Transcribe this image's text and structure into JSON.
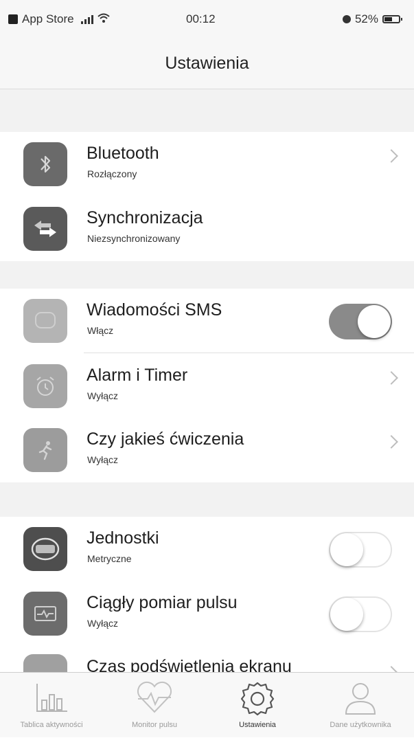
{
  "status_bar": {
    "carrier": "App Store",
    "time": "00:12",
    "battery": "52%"
  },
  "nav": {
    "title": "Ustawienia"
  },
  "sections": [
    {
      "rows": [
        {
          "title": "Bluetooth",
          "subtitle": "Rozłączony",
          "icon": "bluetooth-icon",
          "accessory": "chevron"
        },
        {
          "title": "Synchronizacja",
          "subtitle": "Niezsynchronizowany",
          "icon": "sync-icon",
          "accessory": "none"
        }
      ]
    },
    {
      "rows": [
        {
          "title": "Wiadomości SMS",
          "subtitle": "Włącz",
          "icon": "sms-icon",
          "accessory": "toggle",
          "toggle_on": true
        },
        {
          "title": "Alarm i Timer",
          "subtitle": "Wyłącz",
          "icon": "alarm-clock-icon",
          "accessory": "chevron"
        },
        {
          "title": "Czy jakieś ćwiczenia",
          "subtitle": "Wyłącz",
          "icon": "exercise-icon",
          "accessory": "chevron"
        }
      ]
    },
    {
      "rows": [
        {
          "title": "Jednostki",
          "subtitle": "Metryczne",
          "icon": "units-icon",
          "accessory": "toggle",
          "toggle_on": false
        },
        {
          "title": "Ciągły pomiar pulsu",
          "subtitle": "Wyłącz",
          "icon": "heart-monitor-icon",
          "accessory": "toggle",
          "toggle_on": false
        },
        {
          "title": "Czas podświetlenia ekranu",
          "subtitle": "",
          "icon": "backlight-icon",
          "accessory": "chevron"
        }
      ]
    }
  ],
  "tab_bar": {
    "active_index": 2,
    "tabs": [
      {
        "label": "Tablica aktywności",
        "icon": "activity-chart-icon"
      },
      {
        "label": "Monitor pulsu",
        "icon": "heart-pulse-icon"
      },
      {
        "label": "Ustawienia",
        "icon": "gear-icon"
      },
      {
        "label": "Dane użytkownika",
        "icon": "user-icon"
      }
    ]
  },
  "colors": {
    "toggle_on": "#8a8a8a",
    "icon_dark": "#5f5f5f",
    "icon_light": "#a9a9a9",
    "section_gap": "#f2f2f2"
  }
}
